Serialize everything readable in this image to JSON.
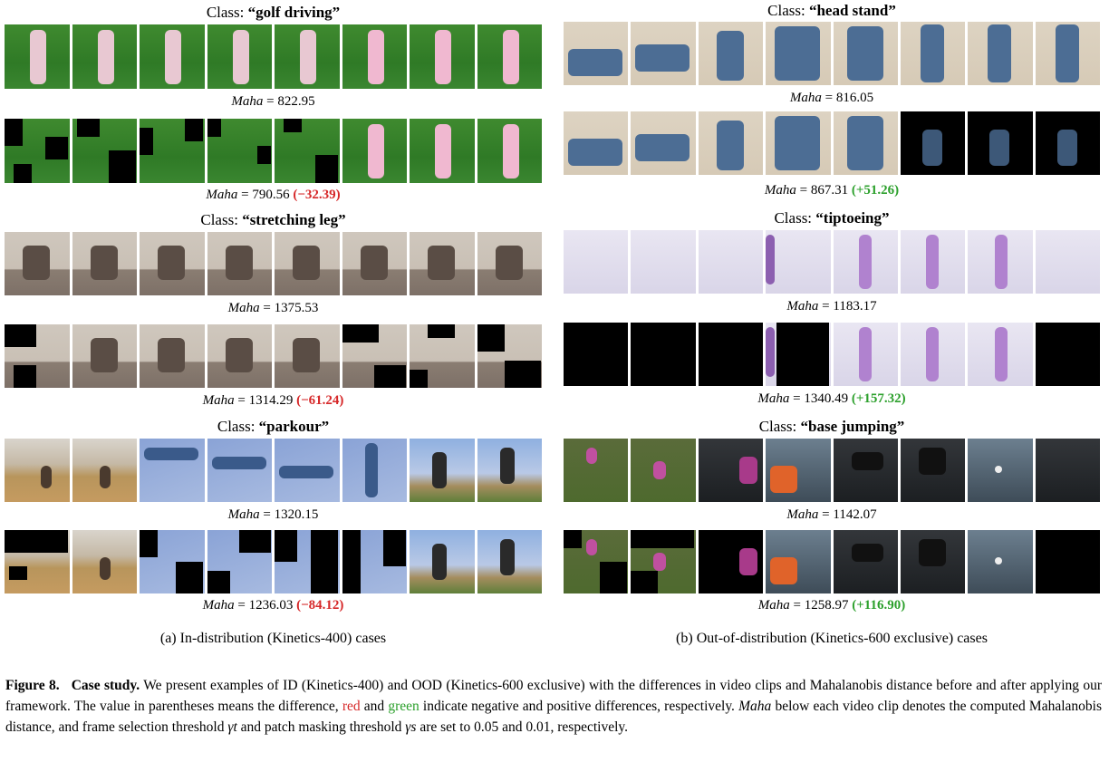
{
  "left": {
    "subcaption": "(a) In-distribution (Kinetics-400) cases",
    "cases": [
      {
        "class_prefix": "Class: ",
        "class_name": "“golf driving”",
        "before": "822.95",
        "after": "790.56",
        "diff": "(−32.39)",
        "diff_sign": "neg"
      },
      {
        "class_prefix": "Class: ",
        "class_name": "“stretching leg”",
        "before": "1375.53",
        "after": "1314.29",
        "diff": "(−61.24)",
        "diff_sign": "neg"
      },
      {
        "class_prefix": "Class: ",
        "class_name": "“parkour”",
        "before": "1320.15",
        "after": "1236.03",
        "diff": "(−84.12)",
        "diff_sign": "neg"
      }
    ]
  },
  "right": {
    "subcaption": "(b) Out-of-distribution (Kinetics-600 exclusive) cases",
    "cases": [
      {
        "class_prefix": "Class: ",
        "class_name": "“head stand”",
        "before": "816.05",
        "after": "867.31",
        "diff": "(+51.26)",
        "diff_sign": "pos"
      },
      {
        "class_prefix": "Class: ",
        "class_name": "“tiptoeing”",
        "before": "1183.17",
        "after": "1340.49",
        "diff": "(+157.32)",
        "diff_sign": "pos"
      },
      {
        "class_prefix": "Class: ",
        "class_name": "“base jumping”",
        "before": "1142.07",
        "after": "1258.97",
        "diff": "(+116.90)",
        "diff_sign": "pos"
      }
    ]
  },
  "metric_label": "Maha",
  "metric_eq": " = ",
  "caption": {
    "label": "Figure 8.",
    "title": "Case study.",
    "text1": " We present examples of ID (Kinetics-400) and OOD (Kinetics-600 exclusive) with the differences in video clips and Mahalanobis distance before and after applying our framework. The value in parentheses means the difference, ",
    "red_word": "red",
    "text2": " and ",
    "green_word": "green",
    "text3": " indicate negative and positive differences, respectively. ",
    "maha": "Maha",
    "text4": " below each video clip denotes the computed Mahalanobis distance, and frame selection threshold ",
    "gamma_t": "γt",
    "text5": " and patch masking threshold ",
    "gamma_s": "γs",
    "text6": " are set to 0.05 and 0.01, respectively."
  }
}
